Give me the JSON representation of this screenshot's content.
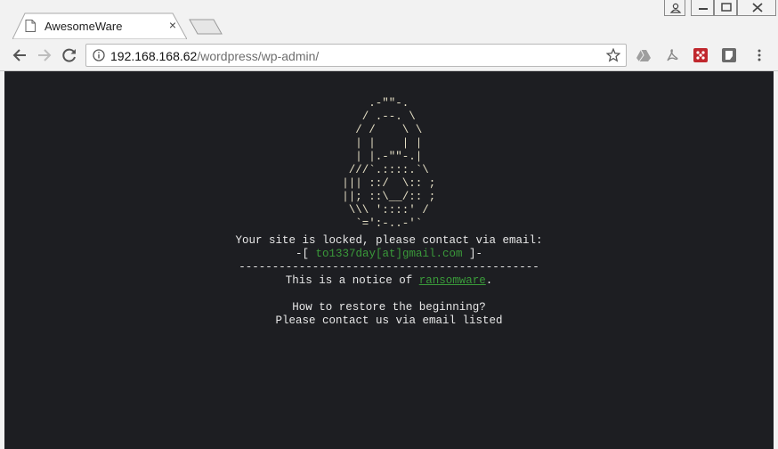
{
  "browser": {
    "tab_title": "AwesomeWare",
    "tab_close": "×",
    "url_host": "192.168.168.62",
    "url_path": "/wordpress/wp-admin/"
  },
  "page": {
    "ascii_lock": "     .-\"\"-.\n    / .--. \\\n   / /    \\ \\\n   | |    | |\n   | |.-\"\"-.|\n  ///`.::::.`\\\n ||| ::/  \\:: ;\n ||; ::\\__/:: ;\n  \\\\\\ '::::' /\n   `=':-..-'`",
    "locked_message": "Your site is locked, please contact via email:",
    "email_prefix": "-[ ",
    "email": "to1337day[at]gmail.com",
    "email_suffix": " ]-",
    "divider": "---------------------------------------------",
    "notice_prefix": "This is a notice of ",
    "notice_link": "ransomware",
    "notice_suffix": ".",
    "restore_question": "How to restore the beginning?",
    "contact_instruction": "Please contact us via email listed"
  },
  "colors": {
    "page_background": "#1d1e22",
    "text": "#e8e8e8",
    "accent_green": "#3a9a3a"
  },
  "icons": [
    "page-icon",
    "close-icon",
    "user-icon",
    "minimize-icon",
    "maximize-icon",
    "window-close-icon",
    "back-arrow-icon",
    "forward-arrow-icon",
    "reload-icon",
    "info-icon",
    "star-icon",
    "google-drive-icon",
    "pdf-icon",
    "red-extension-icon",
    "dark-extension-icon",
    "menu-icon"
  ]
}
